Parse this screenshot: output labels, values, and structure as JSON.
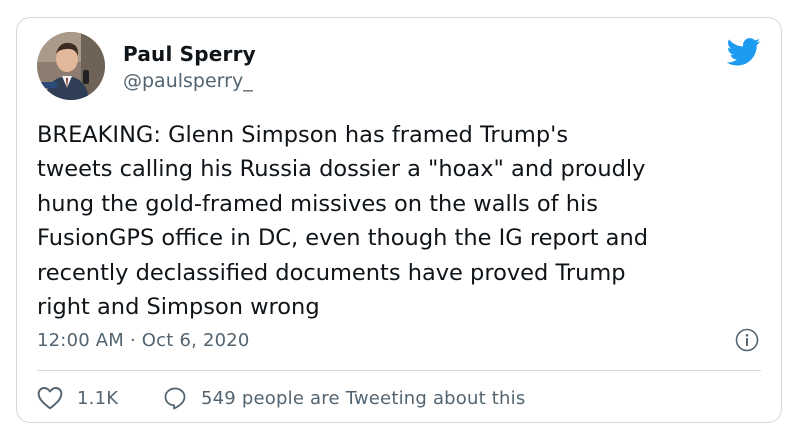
{
  "tweet": {
    "author_name": "Paul Sperry",
    "author_handle": "@paulsperry_",
    "avatar_icon": "profile-photo",
    "brand_icon": "twitter-bird-icon",
    "brand_color": "#1d9bf0",
    "text_lines": [
      "BREAKING: Glenn Simpson has framed Trump's",
      "tweets calling his Russia dossier a \"hoax\" and proudly",
      "hung the gold-framed missives on the walls of his",
      "FusionGPS office in DC, even though the IG report and",
      "recently declassified documents have proved Trump",
      "right and Simpson wrong"
    ],
    "timestamp": "12:00 AM · Oct 6, 2020",
    "info_icon": "info-icon",
    "actions": {
      "likes_icon": "heart-icon",
      "likes_count": "1.1K",
      "conversation_icon": "speech-bubble-icon",
      "conversation_text": "549 people are Tweeting about this"
    }
  },
  "colors": {
    "text_primary": "#0f1419",
    "text_secondary": "#536471",
    "border": "#cfd9de"
  }
}
